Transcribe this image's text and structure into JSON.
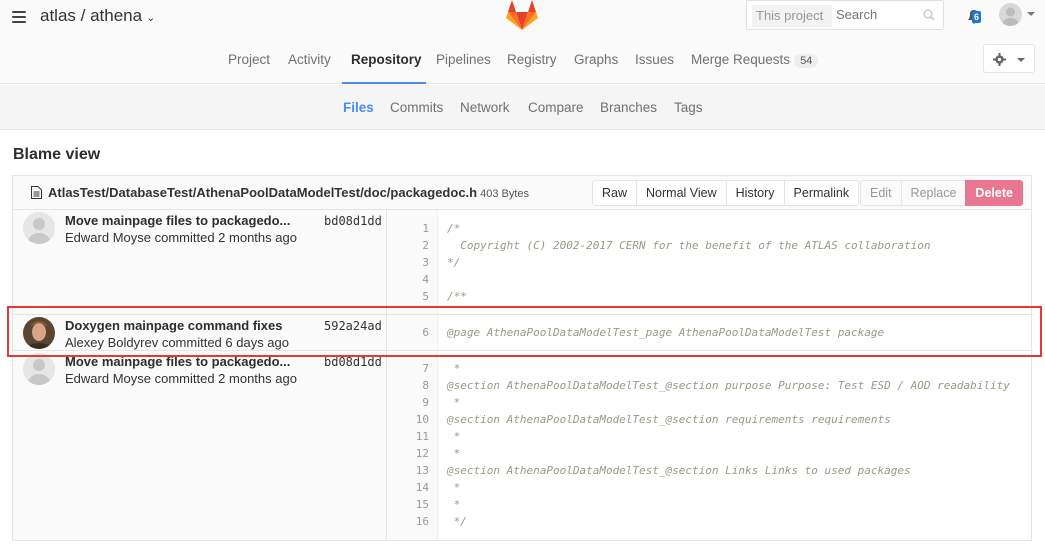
{
  "header": {
    "project_path": "atlas / athena",
    "search_scope": "This project",
    "search_placeholder": "Search",
    "notifications_count": "6"
  },
  "main_nav": {
    "items": [
      {
        "label": "Project",
        "active": false
      },
      {
        "label": "Activity",
        "active": false
      },
      {
        "label": "Repository",
        "active": true
      },
      {
        "label": "Pipelines",
        "active": false
      },
      {
        "label": "Registry",
        "active": false
      },
      {
        "label": "Graphs",
        "active": false
      },
      {
        "label": "Issues",
        "active": false
      },
      {
        "label": "Merge Requests",
        "active": false,
        "count": "54"
      }
    ]
  },
  "sub_nav": {
    "items": [
      {
        "label": "Files",
        "active": true
      },
      {
        "label": "Commits",
        "active": false
      },
      {
        "label": "Network",
        "active": false
      },
      {
        "label": "Compare",
        "active": false
      },
      {
        "label": "Branches",
        "active": false
      },
      {
        "label": "Tags",
        "active": false
      }
    ]
  },
  "page": {
    "title": "Blame view"
  },
  "file": {
    "path": "AtlasTest/DatabaseTest/AthenaPoolDataModelTest/doc/packagedoc.h",
    "size": "403 Bytes",
    "view_buttons": [
      "Raw",
      "Normal View",
      "History",
      "Permalink"
    ],
    "edit_buttons": [
      "Edit",
      "Replace",
      "Delete"
    ]
  },
  "commits": [
    {
      "message": "Move mainpage files to packagedo...",
      "sha": "bd08d1dd",
      "author": "Edward Moyse",
      "meta": "Edward Moyse committed 2 months ago",
      "avatar": "default"
    },
    {
      "message": "Doxygen mainpage command fixes",
      "sha": "592a24ad",
      "author": "Alexey Boldyrev",
      "meta": "Alexey Boldyrev committed 6 days ago",
      "avatar": "photo"
    },
    {
      "message": "Move mainpage files to packagedo...",
      "sha": "bd08d1dd",
      "author": "Edward Moyse",
      "meta": "Edward Moyse committed 2 months ago",
      "avatar": "default"
    }
  ],
  "code_lines": [
    {
      "n": "1",
      "text": "/*"
    },
    {
      "n": "2",
      "text": "  Copyright (C) 2002-2017 CERN for the benefit of the ATLAS collaboration"
    },
    {
      "n": "3",
      "text": "*/"
    },
    {
      "n": "4",
      "text": ""
    },
    {
      "n": "5",
      "text": "/**"
    },
    {
      "n": "6",
      "text": "@page AthenaPoolDataModelTest_page AthenaPoolDataModelTest package"
    },
    {
      "n": "7",
      "text": " *"
    },
    {
      "n": "8",
      "text": "@section AthenaPoolDataModelTest_@section purpose Purpose: Test ESD / AOD readability"
    },
    {
      "n": "9",
      "text": " *"
    },
    {
      "n": "10",
      "text": "@section AthenaPoolDataModelTest_@section requirements requirements"
    },
    {
      "n": "11",
      "text": " *"
    },
    {
      "n": "12",
      "text": " *"
    },
    {
      "n": "13",
      "text": "@section AthenaPoolDataModelTest_@section Links Links to used packages"
    },
    {
      "n": "14",
      "text": " *"
    },
    {
      "n": "15",
      "text": " *"
    },
    {
      "n": "16",
      "text": " */"
    }
  ],
  "colors": {
    "accent": "#4a8bee",
    "danger": "#ea7791",
    "highlight_box": "#e53935",
    "notification_badge": "#1f78d1"
  }
}
